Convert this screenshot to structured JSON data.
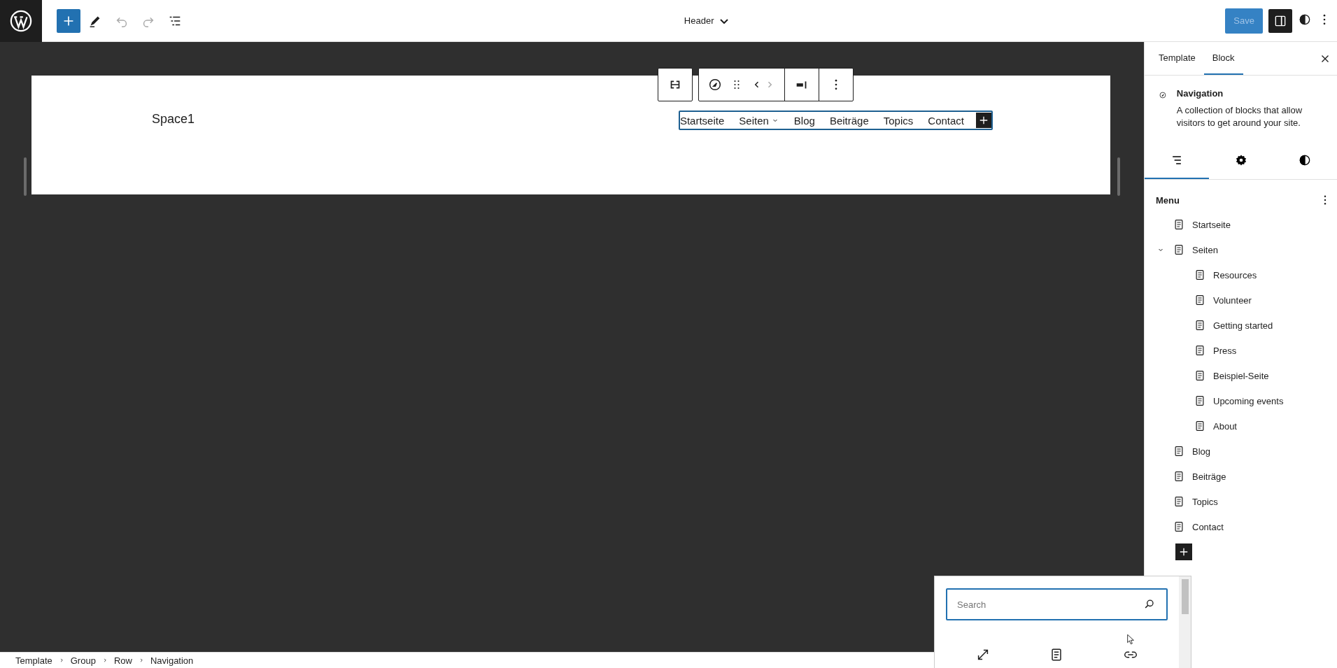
{
  "top_bar": {
    "title": "Header",
    "save_button": {
      "label": "Save",
      "disabled": true
    }
  },
  "canvas": {
    "site_title": "Space1",
    "nav_items": [
      {
        "label": "Startseite",
        "has_submenu": false
      },
      {
        "label": "Seiten",
        "has_submenu": true
      },
      {
        "label": "Blog",
        "has_submenu": false
      },
      {
        "label": "Beiträge",
        "has_submenu": false
      },
      {
        "label": "Topics",
        "has_submenu": false
      },
      {
        "label": "Contact",
        "has_submenu": false
      }
    ]
  },
  "sidebar": {
    "tabs": [
      {
        "label": "Template",
        "selected": false
      },
      {
        "label": "Block",
        "selected": true
      }
    ],
    "block": {
      "name": "Navigation",
      "description": "A collection of blocks that allow visitors to get around your site."
    },
    "panel_tabs": [
      {
        "kind": "list",
        "selected": true
      },
      {
        "kind": "settings",
        "selected": false
      },
      {
        "kind": "styles",
        "selected": false
      }
    ],
    "menu": {
      "title": "Menu",
      "items": [
        {
          "label": "Startseite"
        },
        {
          "label": "Seiten",
          "expanded": true,
          "children": [
            {
              "label": "Resources"
            },
            {
              "label": "Volunteer"
            },
            {
              "label": "Getting started"
            },
            {
              "label": "Press"
            },
            {
              "label": "Beispiel-Seite"
            },
            {
              "label": "Upcoming events"
            },
            {
              "label": "About"
            }
          ]
        },
        {
          "label": "Blog"
        },
        {
          "label": "Beiträge"
        },
        {
          "label": "Topics"
        },
        {
          "label": "Contact"
        }
      ]
    }
  },
  "inserter": {
    "search": {
      "placeholder": "Search"
    },
    "items": [
      {
        "kind": "expand"
      },
      {
        "kind": "page"
      },
      {
        "kind": "link"
      }
    ]
  },
  "breadcrumb": [
    "Template",
    "Group",
    "Row",
    "Navigation"
  ]
}
